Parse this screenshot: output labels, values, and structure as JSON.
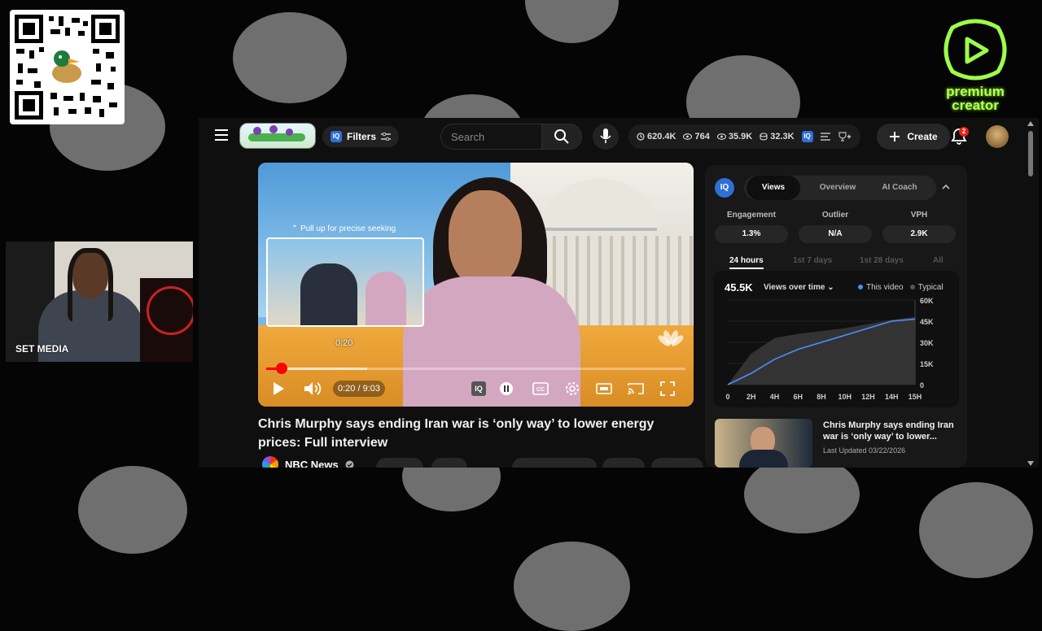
{
  "overlay": {
    "camera_label": "SET MEDIA",
    "logo_text": "premium creator",
    "logo_color": "#9dff4a"
  },
  "header": {
    "search_placeholder": "Search",
    "filters_label": "Filters",
    "iq_label": "IQ",
    "stats": [
      {
        "icon": "clock-icon",
        "value": "620.4K"
      },
      {
        "icon": "eye-icon",
        "value": "764"
      },
      {
        "icon": "eye-icon",
        "value": "35.9K"
      },
      {
        "icon": "coins-icon",
        "value": "32.3K"
      }
    ],
    "create_label": "Create",
    "notification_count": "2"
  },
  "player": {
    "pull_hint": "Pull up for precise seeking",
    "seek_preview_time": "0:20",
    "time_display": "0:20 / 9:03",
    "progress": 0.037,
    "buffered": 0.24,
    "accent": "#ff0000"
  },
  "video": {
    "title": "Chris Murphy says ending Iran war is ‘only way’ to lower energy prices: Full interview",
    "channel": "NBC News"
  },
  "panel": {
    "tabs": [
      "Views",
      "Overview",
      "AI Coach"
    ],
    "active_tab": "Views",
    "metrics": [
      {
        "label": "Engagement",
        "value": "1.3%"
      },
      {
        "label": "Outlier",
        "value": "N/A"
      },
      {
        "label": "VPH",
        "value": "2.9K"
      }
    ],
    "periods": [
      "24 hours",
      "1st 7 days",
      "1st 28 days",
      "All"
    ],
    "active_period": "24 hours",
    "total_views": "45.5K",
    "views_dropdown": "Views over time",
    "legend_this": "This video",
    "legend_typical": "Typical",
    "related": {
      "title": "Chris Murphy says ending Iran war is ‘only way’ to lower...",
      "date": "Last Updated 03/22/2026"
    }
  },
  "chart_data": {
    "type": "line",
    "x": [
      "0",
      "2H",
      "4H",
      "6H",
      "8H",
      "10H",
      "12H",
      "14H",
      "15H"
    ],
    "y_ticks": [
      0,
      15000,
      30000,
      45000,
      60000
    ],
    "y_tick_labels": [
      "0",
      "15K",
      "30K",
      "45K",
      "60K"
    ],
    "ylim": [
      0,
      60000
    ],
    "series": [
      {
        "name": "This video",
        "color": "#4a90ff",
        "values": [
          0,
          8000,
          18000,
          25000,
          30000,
          35000,
          40000,
          45000,
          46500
        ]
      },
      {
        "name": "Typical",
        "color": "#3a3a3a",
        "values": [
          0,
          22000,
          33000,
          36000,
          38000,
          40000,
          43000,
          46000,
          48000
        ]
      }
    ]
  }
}
